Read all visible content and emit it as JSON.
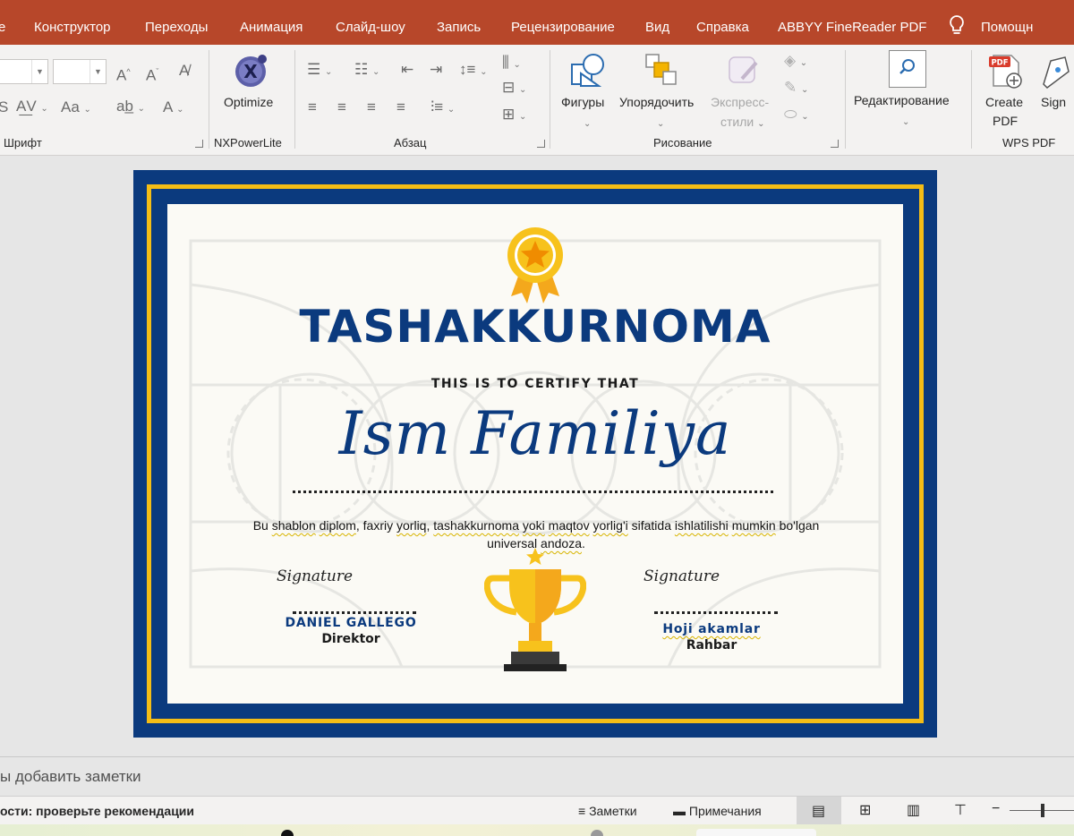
{
  "menubar": {
    "tabs": [
      "е",
      "Конструктор",
      "Переходы",
      "Анимация",
      "Слайд-шоу",
      "Запись",
      "Рецензирование",
      "Вид",
      "Справка",
      "ABBYY FineReader PDF"
    ],
    "help": "Помощн"
  },
  "ribbon": {
    "groups": {
      "font": "Шрифт",
      "nxpowerlite": "NXPowerLite",
      "paragraph": "Абзац",
      "drawing": "Рисование",
      "wps": "WPS PDF"
    },
    "optimize": "Optimize",
    "shapes": "Фигуры",
    "arrange": "Упорядочить",
    "quick_styles_1": "Экспресс-",
    "quick_styles_2": "стили",
    "editing": "Редактирование",
    "create_pdf_1": "Create",
    "create_pdf_2": "PDF",
    "sign": "Sign",
    "pdf_badge": "PDF"
  },
  "certificate": {
    "title": "TASHAKKURNOMA",
    "subtitle": "THIS IS TO CERTIFY THAT",
    "name": "Ism Familiya",
    "body_parts": [
      "Bu ",
      "shablon",
      " ",
      "diplom",
      ", faxriy ",
      "yorliq",
      ", ",
      "tashakkurnoma",
      " ",
      "yoki",
      " ",
      "maqtov",
      " ",
      "yorlig'i",
      " sifatida ",
      "ishlatilishi",
      " ",
      "mumkin",
      " bo'lgan universal ",
      "andoza",
      "."
    ],
    "left_signature": {
      "script": "Signature",
      "name": "DANIEL GALLEGO",
      "role": "Direktor"
    },
    "right_signature": {
      "script": "Signature",
      "name": "Hoji akamlar",
      "role": "Rahbar"
    },
    "colors": {
      "navy": "#0b3a7e",
      "gold": "#f4bd16",
      "paper": "#fbfaf5"
    }
  },
  "notes": {
    "placeholder": "ы добавить заметки"
  },
  "status": {
    "accessibility": "ости: проверьте рекомендации",
    "notes_btn": "Заметки",
    "comments_btn": "Примечания",
    "zoom_minus": "−"
  }
}
